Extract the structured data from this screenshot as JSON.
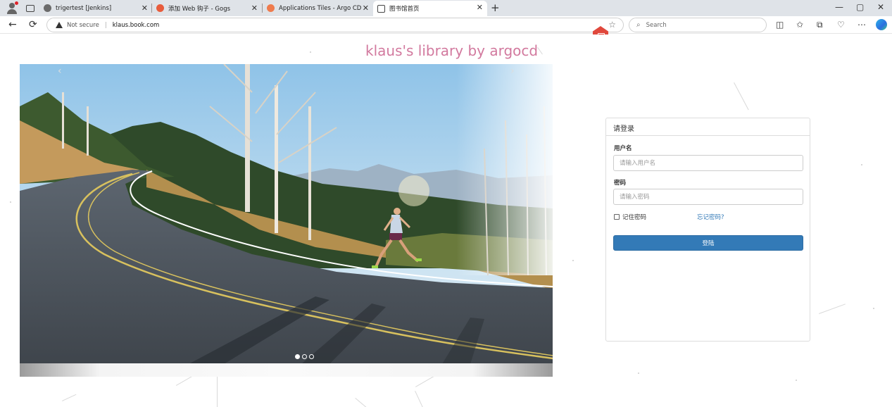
{
  "browser": {
    "tabs": [
      {
        "title": "trigertest [Jenkins]",
        "favicon_color": "#6b6b6b",
        "active": false
      },
      {
        "title": "添加 Web 钩子 - Gogs",
        "favicon_color": "#e85c3c",
        "active": false
      },
      {
        "title": "Applications Tiles - Argo CD",
        "favicon_color": "#ef7b4d",
        "active": false
      },
      {
        "title": "图书馆首页",
        "favicon_color": "#ffffff",
        "active": true
      }
    ],
    "close_glyph": "✕",
    "new_tab_glyph": "+",
    "window_controls": [
      "—",
      "▢",
      "✕"
    ],
    "address": {
      "security_label": "Not secure",
      "url": "klaus.book.com"
    },
    "search_placeholder": "Search",
    "accent_color": "#337ab7"
  },
  "page": {
    "title": "klaus's library by argocd",
    "title_color": "#d2799e",
    "carousel": {
      "prev_glyph": "‹",
      "next_glyph": "›",
      "slide_count": 3,
      "active_slide": 1,
      "image_description_icon": "mountain-road-runner-photo"
    },
    "login": {
      "heading": "请登录",
      "username_label": "用户名",
      "username_placeholder": "请输入用户名",
      "password_label": "密码",
      "password_placeholder": "请输入密码",
      "remember_label": "记住密码",
      "forgot_link": "忘记密码?",
      "submit_label": "登陆"
    }
  }
}
